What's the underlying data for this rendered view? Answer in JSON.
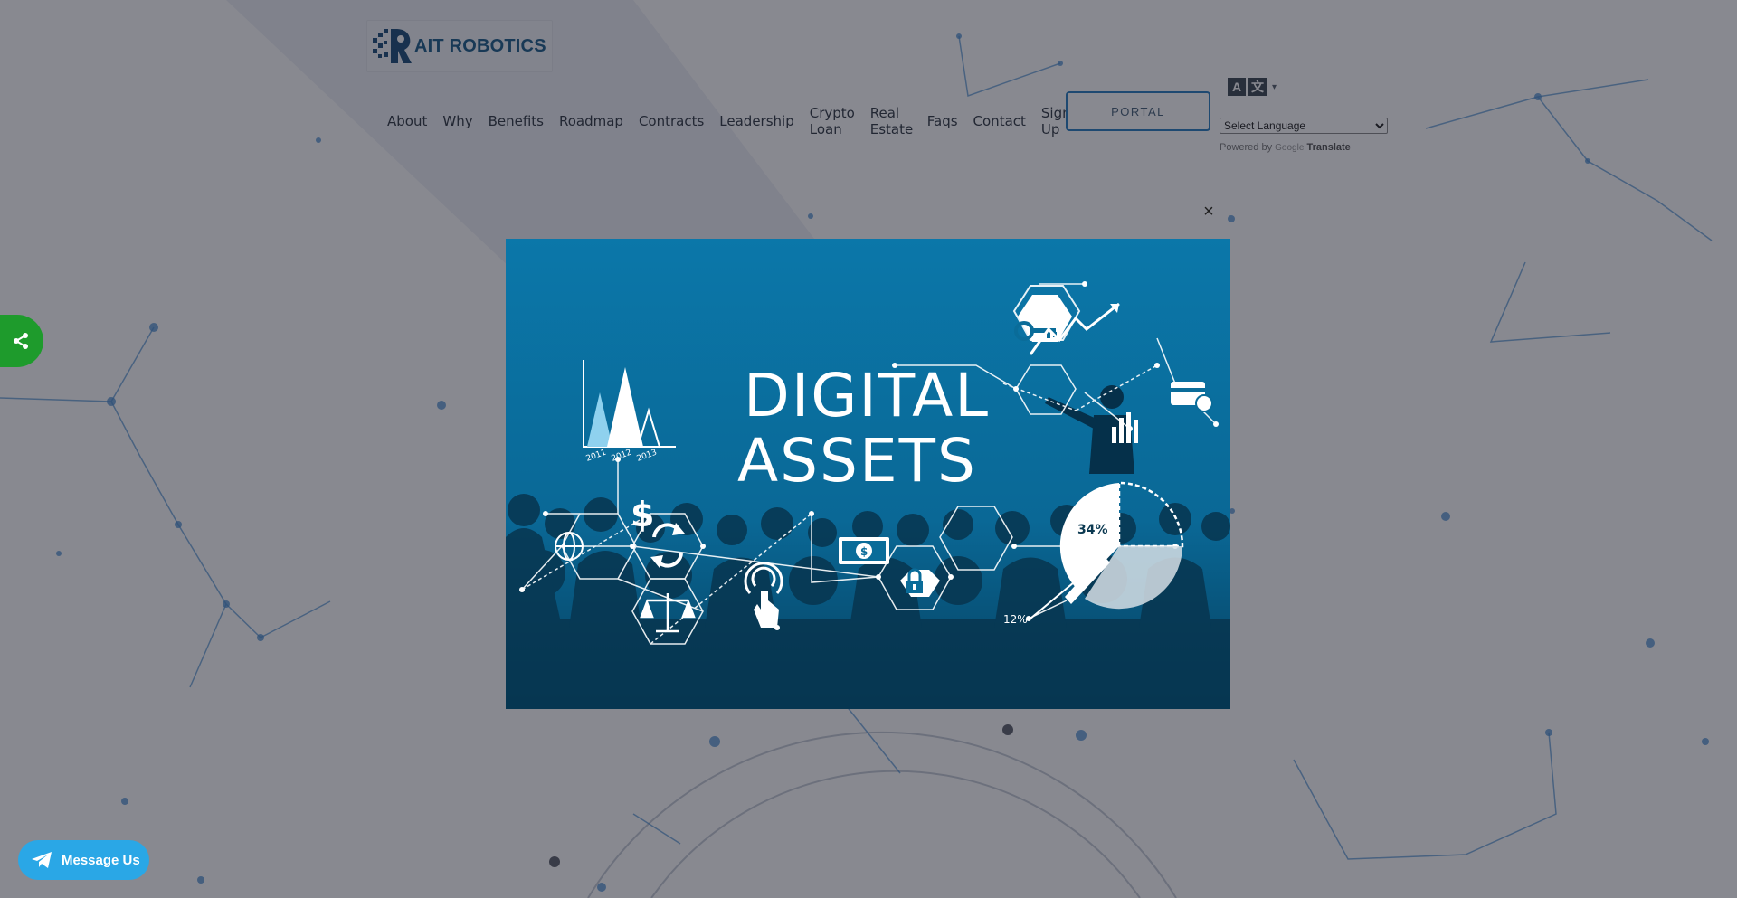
{
  "header": {
    "logo_text": "AIT ROBOTICS",
    "nav": [
      "About",
      "Why",
      "Benefits",
      "Roadmap",
      "Contracts",
      "Leadership",
      "Crypto Loan",
      "Real Estate",
      "Faqs",
      "Contact",
      "Sign Up"
    ],
    "portal_label": "PORTAL",
    "translate": {
      "select_value": "Select Language",
      "powered_by": "Powered by",
      "google": "Google",
      "translate": "Translate"
    }
  },
  "modal": {
    "close_symbol": "×",
    "title_line1": "DIGITAL",
    "title_line2": "ASSETS",
    "chart_years": [
      "2011",
      "2012",
      "2013"
    ],
    "pie_label_big": "34%",
    "pie_label_small": "12%"
  },
  "widgets": {
    "message_label": "Message Us"
  },
  "colors": {
    "accent": "#2b7fc1",
    "share_green": "#1e9b2c",
    "message_blue": "#2aa7e6",
    "modal_blue": "#0a6c99"
  },
  "icons": [
    "share-icon",
    "telegram-icon",
    "translate-icon",
    "close-icon"
  ]
}
